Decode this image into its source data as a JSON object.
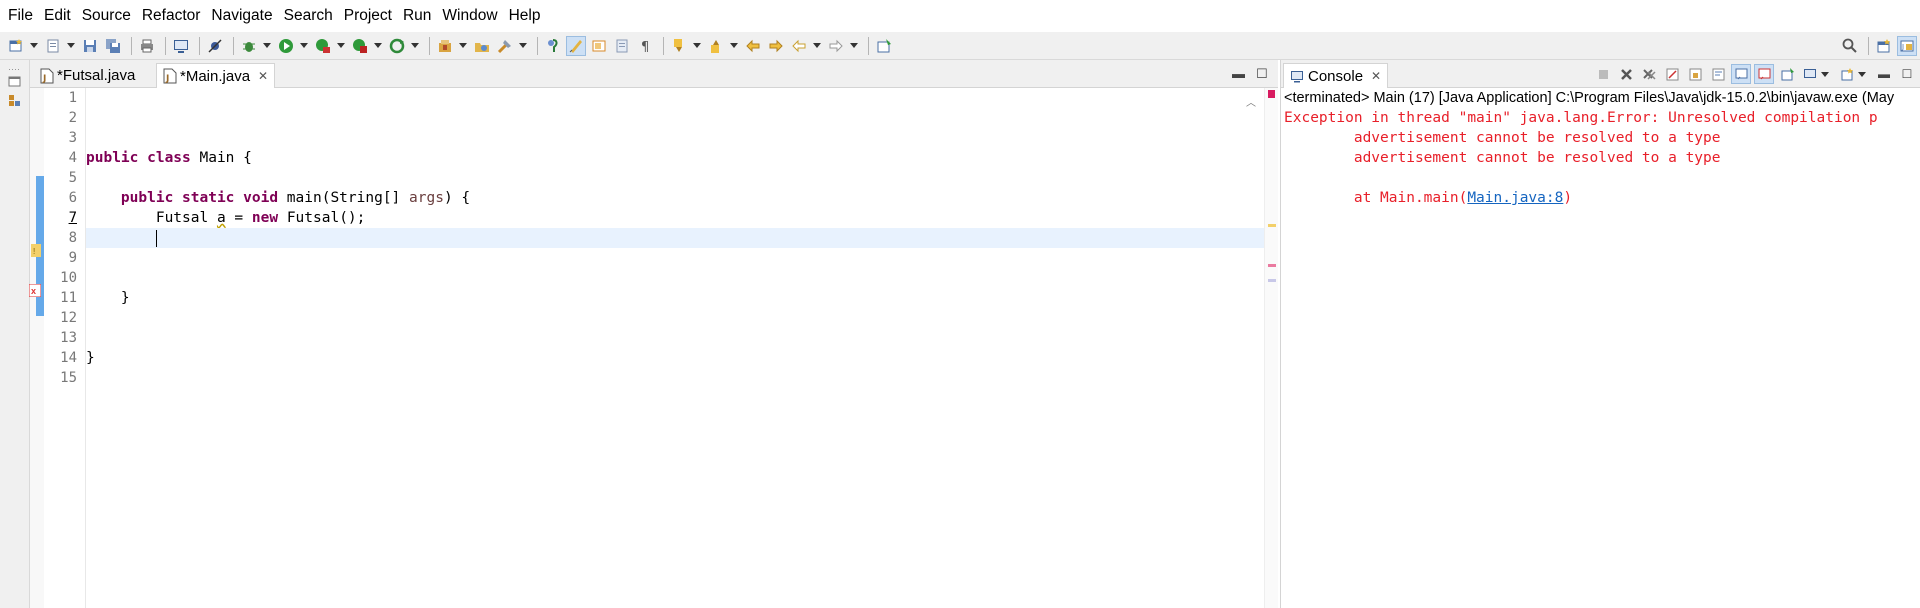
{
  "menu": [
    "File",
    "Edit",
    "Source",
    "Refactor",
    "Navigate",
    "Search",
    "Project",
    "Run",
    "Window",
    "Help"
  ],
  "editor": {
    "tabs": [
      {
        "label": "*Futsal.java",
        "active": false
      },
      {
        "label": "*Main.java",
        "active": true
      }
    ],
    "line_numbers": [
      "1",
      "2",
      "3",
      "4",
      "5",
      "6",
      "7",
      "8",
      "9",
      "10",
      "11",
      "12",
      "13",
      "14",
      "15"
    ],
    "current_line": "7",
    "code": {
      "l3_kw": "public class",
      "l3_rest": " Main {",
      "l5_kw": "public static void",
      "l5_mid": " main(String[] ",
      "l5_param": "args",
      "l5_end": ") {",
      "l6_a": "Futsal ",
      "l6_var": "a",
      "l6_b": " = ",
      "l6_kw": "new",
      "l6_c": " Futsal();",
      "l11": "}",
      "l14": "}"
    }
  },
  "console": {
    "tab_label": "Console",
    "status": "<terminated> Main (17) [Java Application] C:\\Program Files\\Java\\jdk-15.0.2\\bin\\javaw.exe  (May",
    "lines": [
      "Exception in thread \"main\" java.lang.Error: Unresolved compilation p",
      "        advertisement cannot be resolved to a type",
      "        advertisement cannot be resolved to a type",
      ""
    ],
    "trace_prefix": "        at Main.main(",
    "trace_link": "Main.java:8",
    "trace_suffix": ")"
  },
  "colors": {
    "keyword": "#7f0055",
    "error_text": "#e8202a",
    "link": "#1565c0",
    "current_line_bg": "#e8f2fe",
    "change_bar": "#4b9be6"
  },
  "icons": {
    "toolbar": [
      "new-wizard-icon",
      "new-file-icon",
      "save-icon",
      "save-all-icon",
      "print-icon",
      "binary-icon",
      "terminal-icon",
      "skip-breakpoints-icon",
      "debug-icon",
      "run-icon",
      "coverage-icon",
      "external-tools-icon",
      "refresh-icon",
      "new-java-project-icon",
      "open-type-icon",
      "search-tool-icon",
      "toggle-mark-occurrences-icon",
      "toggle-edit-icon",
      "block-selection-icon",
      "show-whitespace-icon",
      "next-annotation-icon",
      "previous-annotation-icon",
      "last-edit-icon",
      "back-icon",
      "forward-icon",
      "pin-editor-icon",
      "search-icon",
      "open-perspective-icon",
      "java-perspective-icon"
    ]
  }
}
